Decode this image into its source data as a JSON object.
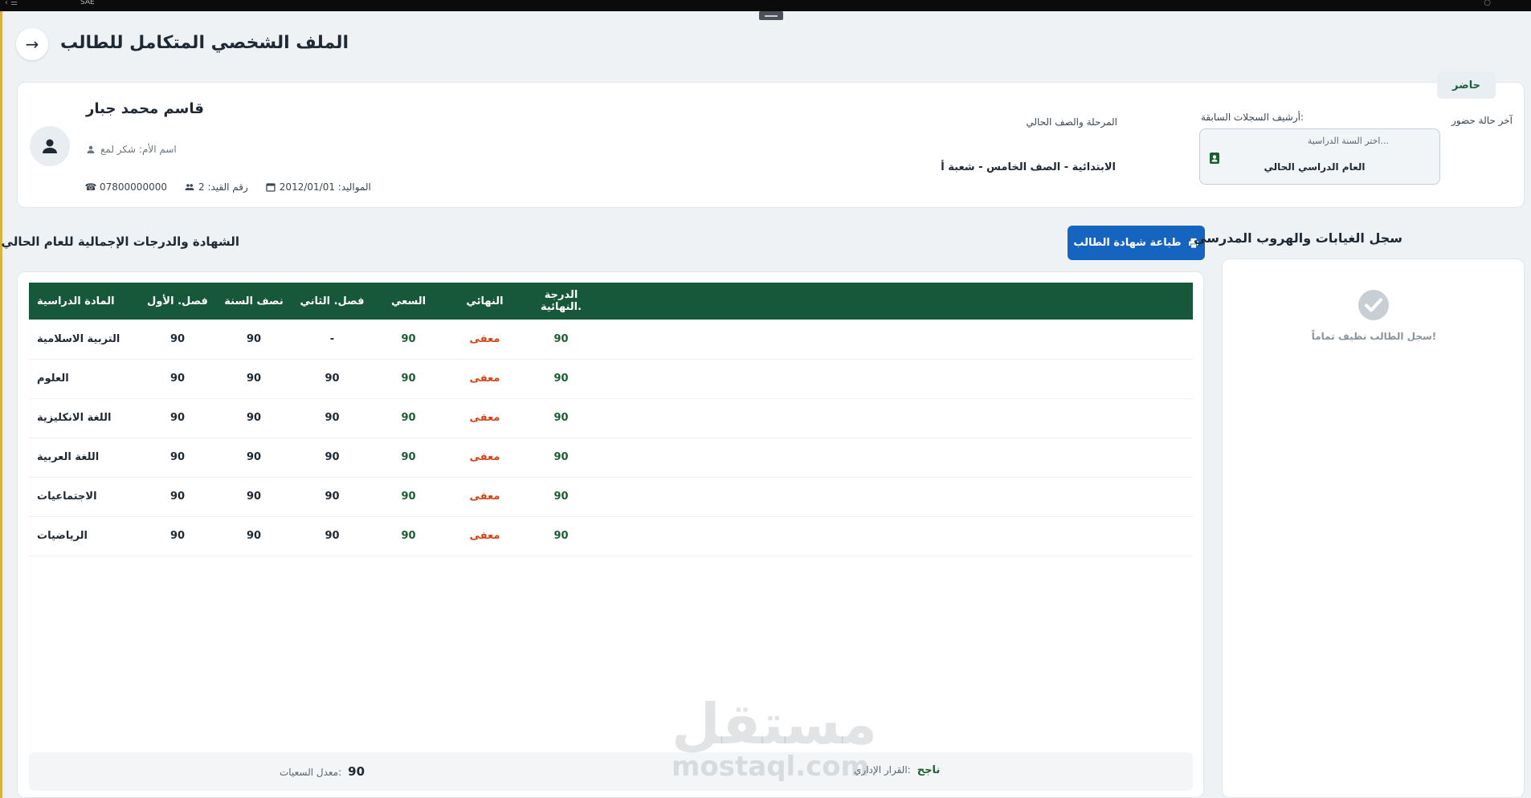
{
  "window": {
    "app_title": "SAE"
  },
  "header": {
    "title": "الملف الشخصي المتكامل للطالب",
    "back_icon": "arrow-right-icon"
  },
  "student": {
    "name": "قاسم محمد جبار",
    "mother_label": "اسم الأم: شكر لمع",
    "birth_label": "المواليد: 2012/01/01",
    "registry_label": "رقم القيد: 2",
    "phone": "07800000000"
  },
  "stage": {
    "label": "المرحلة والصف الحالي",
    "value": "الابتدائية - الصف الخامس - شعبة أ"
  },
  "archive": {
    "label": "أرشيف السجلات السابقة:",
    "placeholder": "اختر السنة الدراسية...",
    "selected": "العام الدراسي الحالي"
  },
  "attendance": {
    "label": "آخر حالة حضور",
    "status": "حاضر"
  },
  "certificate": {
    "title": "الشهادة والدرجات الإجمالية للعام الحالي",
    "print_label": "طباعة شهادة الطالب",
    "columns": [
      "المادة الدراسية",
      "فصل. الأول",
      "نصف السنة",
      "فصل. الثاني",
      "السعي",
      "النهائي",
      "الدرجة .النهائية"
    ],
    "rows": [
      {
        "subject": "التربية الاسلامية",
        "term1": "90",
        "mid": "90",
        "term2": "-",
        "effort": "90",
        "final": "معفى",
        "total": "90"
      },
      {
        "subject": "العلوم",
        "term1": "90",
        "mid": "90",
        "term2": "90",
        "effort": "90",
        "final": "معفى",
        "total": "90"
      },
      {
        "subject": "اللغة الانكليزية",
        "term1": "90",
        "mid": "90",
        "term2": "90",
        "effort": "90",
        "final": "معفى",
        "total": "90"
      },
      {
        "subject": "اللغة العربية",
        "term1": "90",
        "mid": "90",
        "term2": "90",
        "effort": "90",
        "final": "معفى",
        "total": "90"
      },
      {
        "subject": "الاجتماعيات",
        "term1": "90",
        "mid": "90",
        "term2": "90",
        "effort": "90",
        "final": "معفى",
        "total": "90"
      },
      {
        "subject": "الرياضيات",
        "term1": "90",
        "mid": "90",
        "term2": "90",
        "effort": "90",
        "final": "معفى",
        "total": "90"
      }
    ],
    "summary": {
      "avg_label": "معدل السعيات:",
      "avg_value": "90",
      "decision_label": "القرار الإداري:",
      "decision_value": "ناجح"
    }
  },
  "absence": {
    "title": "سجل الغيابات والهروب المدرسي",
    "empty_text": "سجل الطالب نظيف تماماً!"
  },
  "watermark": {
    "top": "مستقل",
    "bottom": "mostaql.com"
  },
  "colors": {
    "header_green": "#17573a",
    "grade_green": "#1b5e32",
    "exempt_red": "#d84315",
    "primary_blue": "#1565c0",
    "background": "#eef2f5"
  }
}
